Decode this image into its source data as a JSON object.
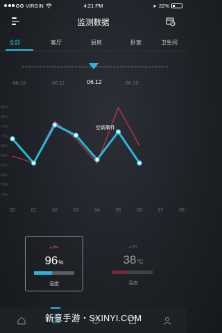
{
  "status_bar": {
    "carrier": "VIRGIN",
    "time": "4:21 PM",
    "battery": "22%"
  },
  "header": {
    "title": "监测数据",
    "menu_icon": "menu-icon",
    "schedule_icon": "schedule-icon"
  },
  "tabs": [
    {
      "label": "全部",
      "active": true
    },
    {
      "label": "客厅",
      "active": false
    },
    {
      "label": "厨房",
      "active": false
    },
    {
      "label": "卧室",
      "active": false
    },
    {
      "label": "卫生间",
      "active": false
    }
  ],
  "timeline": {
    "dates": [
      "06.10",
      "06.11",
      "06.12",
      "06.13"
    ],
    "selected": "06.12"
  },
  "colors": {
    "accent": "#28b8de",
    "secondary": "#c0304a",
    "muted_text": "#6a7077"
  },
  "chart_data": {
    "type": "line",
    "x": [
      "00",
      "01",
      "02",
      "03",
      "04",
      "05",
      "06",
      "07",
      "08"
    ],
    "y_tick_labels": [
      "85%",
      "80%",
      "75%",
      "70%",
      "65%",
      "60%",
      "55%",
      "50%",
      "75%",
      "70%"
    ],
    "series": [
      {
        "name": "湿度",
        "color": "#28b8de",
        "values": [
          79,
          72,
          83,
          80,
          73,
          81,
          72
        ]
      },
      {
        "name": "温度",
        "color": "#c0304a",
        "values": [
          74,
          72,
          84,
          79,
          72,
          88,
          77
        ]
      }
    ],
    "annotation": "空调事件"
  },
  "cards": [
    {
      "name": "humidity",
      "small": "8%",
      "value": "96",
      "unit": "%",
      "label": "湿度",
      "active": true,
      "fill": 0.45,
      "fill_color": "#28b8de"
    },
    {
      "name": "temperature",
      "small": "8%",
      "value": "38",
      "unit": "°C",
      "label": "温度",
      "active": false,
      "fill": 0.4,
      "fill_color": "#c0304a"
    }
  ],
  "bottom_tabs": [
    "home-icon",
    "monitor-icon",
    "device-icon",
    "scene-icon",
    "profile-icon"
  ],
  "watermark": "新意手游・SXINYI.COM"
}
